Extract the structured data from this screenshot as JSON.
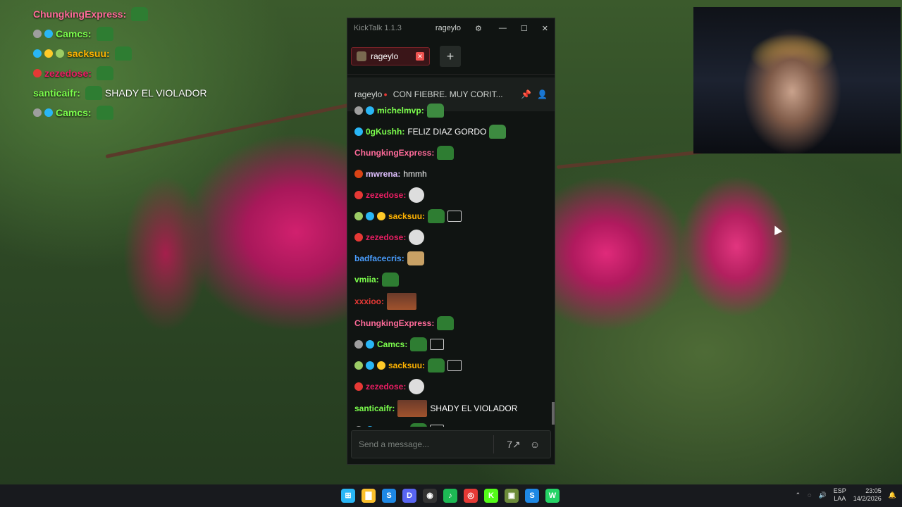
{
  "overlay_chat": [
    {
      "user": "ChungkingExpress:",
      "color": "#ff6b9a",
      "badges": [],
      "message": ""
    },
    {
      "user": "Camcs:",
      "color": "#7cff4d",
      "badges": [
        "#9e9e9e",
        "#29b6f6"
      ],
      "message": ""
    },
    {
      "user": "sacksuu:",
      "color": "#ffb300",
      "badges": [
        "#29b6f6",
        "#ffca28",
        "#9ccc65"
      ],
      "message": ""
    },
    {
      "user": "zezedose:",
      "color": "#e91e63",
      "badges": [
        "#e53935"
      ],
      "message": ""
    },
    {
      "user": "santicaifr:",
      "color": "#7cff4d",
      "badges": [],
      "message": "SHADY EL VIOLADOR"
    },
    {
      "user": "Camcs:",
      "color": "#7cff4d",
      "badges": [
        "#9e9e9e",
        "#29b6f6"
      ],
      "message": ""
    }
  ],
  "window": {
    "title": "KickTalk 1.1.3",
    "user": "rageylo",
    "gear_icon": "⚙",
    "minimize": "—",
    "maximize": "☐",
    "close": "✕"
  },
  "tab": {
    "label": "rageylo",
    "close": "✕",
    "add": "+"
  },
  "stream": {
    "channel": "rageylo",
    "live_dot": "●",
    "title": "CON FIEBRE. MUY CORIT...",
    "pin_icon": "📌",
    "user_icon": "👤"
  },
  "chat": [
    {
      "user": "michelmvp:",
      "color": "#7cff4d",
      "badges": [
        "#9e9e9e",
        "#29b6f6"
      ],
      "message": "",
      "emotes": [
        "frog"
      ]
    },
    {
      "user": "0gKushh:",
      "color": "#7cff4d",
      "badges": [
        "#29b6f6"
      ],
      "message": "FELIZ DIAZ GORDO",
      "emotes": [
        "frog"
      ]
    },
    {
      "user": "ChungkingExpress:",
      "color": "#ff6b9a",
      "badges": [],
      "message": "",
      "emotes": [
        "emote"
      ]
    },
    {
      "user": "mwrena:",
      "color": "#e0c0ff",
      "badges": [
        "#d84315"
      ],
      "message": "hmmh",
      "emotes": []
    },
    {
      "user": "zezedose:",
      "color": "#e91e63",
      "badges": [
        "#e53935"
      ],
      "message": "",
      "emotes": [
        "face"
      ]
    },
    {
      "user": "sacksuu:",
      "color": "#ffb300",
      "badges": [
        "#9ccc65",
        "#29b6f6",
        "#ffca28"
      ],
      "message": "",
      "emotes": [
        "emote",
        "sketch"
      ]
    },
    {
      "user": "zezedose:",
      "color": "#e91e63",
      "badges": [
        "#e53935"
      ],
      "message": "",
      "emotes": [
        "face"
      ]
    },
    {
      "user": "badfacecris:",
      "color": "#4a9eff",
      "badges": [],
      "message": "",
      "emotes": [
        "dog"
      ]
    },
    {
      "user": "vmiia:",
      "color": "#7cff4d",
      "badges": [],
      "message": "",
      "emotes": [
        "emote"
      ]
    },
    {
      "user": "xxxioo:",
      "color": "#e53935",
      "badges": [],
      "message": "",
      "emotes": [
        "photo"
      ]
    },
    {
      "user": "ChungkingExpress:",
      "color": "#ff6b9a",
      "badges": [],
      "message": "",
      "emotes": [
        "emote"
      ]
    },
    {
      "user": "Camcs:",
      "color": "#7cff4d",
      "badges": [
        "#9e9e9e",
        "#29b6f6"
      ],
      "message": "",
      "emotes": [
        "emote",
        "sketch"
      ]
    },
    {
      "user": "sacksuu:",
      "color": "#ffb300",
      "badges": [
        "#9ccc65",
        "#29b6f6",
        "#ffca28"
      ],
      "message": "",
      "emotes": [
        "emote",
        "sketch"
      ]
    },
    {
      "user": "zezedose:",
      "color": "#e91e63",
      "badges": [
        "#e53935"
      ],
      "message": "",
      "emotes": [
        "face"
      ]
    },
    {
      "user": "santicaifr:",
      "color": "#7cff4d",
      "badges": [],
      "message": "SHADY EL VIOLADOR",
      "emotes": [
        "photo"
      ]
    },
    {
      "user": "Camcs:",
      "color": "#7cff4d",
      "badges": [
        "#9e9e9e",
        "#29b6f6"
      ],
      "message": "",
      "emotes": [
        "emote",
        "sketch"
      ]
    }
  ],
  "input": {
    "placeholder": "Send a message...",
    "translate_icon": "7↗",
    "emote_icon": "☺"
  },
  "taskbar": {
    "apps": [
      {
        "name": "windows-start-icon",
        "glyph": "⊞",
        "color": "#29b6f6"
      },
      {
        "name": "file-explorer-icon",
        "glyph": "▇",
        "color": "#fbc02d"
      },
      {
        "name": "steam-icon",
        "glyph": "S",
        "color": "#1e88e5"
      },
      {
        "name": "discord-icon",
        "glyph": "D",
        "color": "#5865f2"
      },
      {
        "name": "obs-icon",
        "glyph": "◉",
        "color": "#333"
      },
      {
        "name": "spotify-icon",
        "glyph": "♪",
        "color": "#1db954"
      },
      {
        "name": "chrome-icon",
        "glyph": "◎",
        "color": "#e53935"
      },
      {
        "name": "kick-icon",
        "glyph": "K",
        "color": "#53fc18"
      },
      {
        "name": "minecraft-icon",
        "glyph": "▣",
        "color": "#6d8b3a"
      },
      {
        "name": "steam2-icon",
        "glyph": "S",
        "color": "#1e88e5"
      },
      {
        "name": "whatsapp-icon",
        "glyph": "W",
        "color": "#25d366"
      }
    ],
    "lang_top": "ESP",
    "lang_bottom": "LAA",
    "time": "23:05",
    "date": "14/2/2026"
  }
}
